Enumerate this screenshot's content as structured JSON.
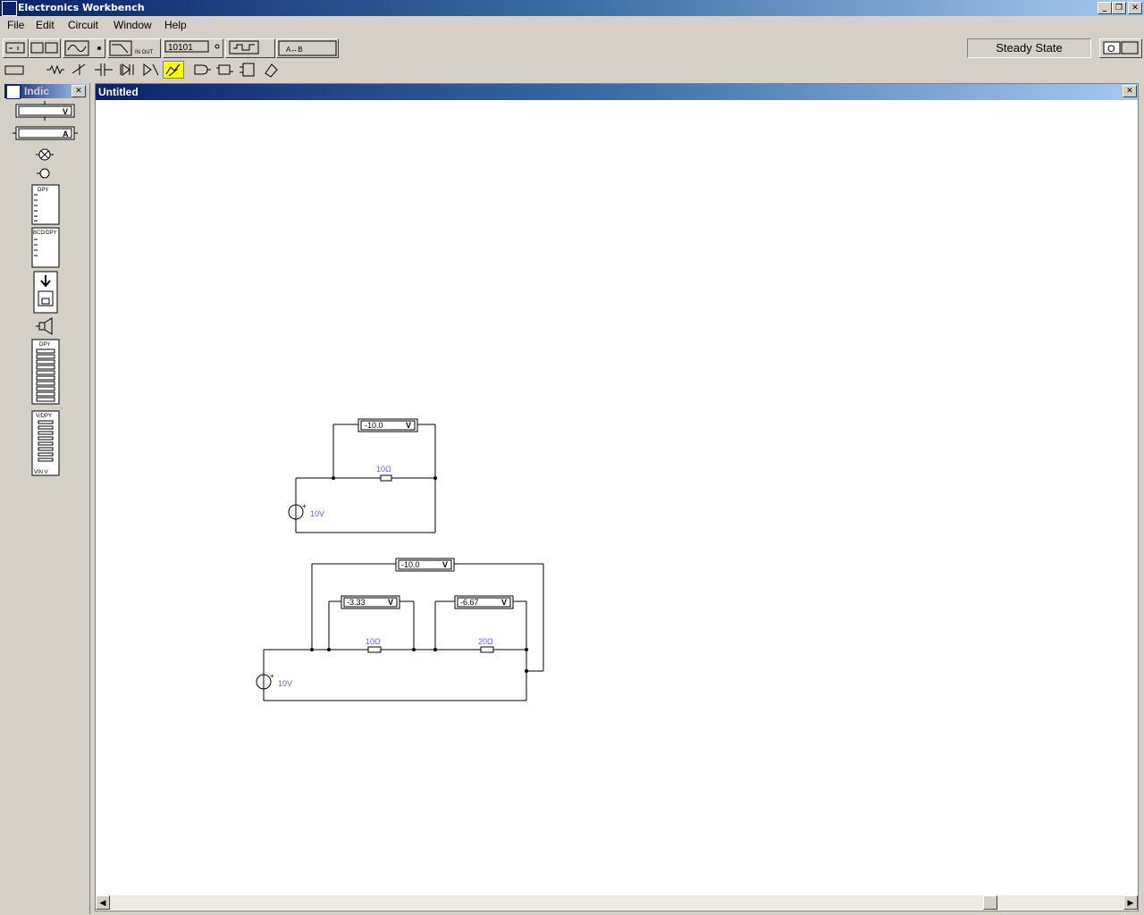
{
  "app": {
    "title": "Electronics Workbench",
    "window_buttons": {
      "minimize": "_",
      "restore": "❐",
      "close": "✕"
    }
  },
  "menu": [
    "File",
    "Edit",
    "Circuit",
    "Window",
    "Help"
  ],
  "toolbar": {
    "status": "Steady State",
    "power_label": "O",
    "instrument_labels": {
      "analyzer": "10101",
      "bode": "IN OUT",
      "logic": "A↔B"
    }
  },
  "parts_bin": {
    "title": "Indic",
    "voltmeter_label": "V",
    "ammeter_label": "A",
    "dpy_label": "DPY",
    "bcd_label": "BCD/DPY",
    "bargraph_label": "DPY",
    "vdpy_label": "V/DPY",
    "vin_label": "VIN V"
  },
  "canvas": {
    "title": "Untitled",
    "circuit1": {
      "voltmeter": {
        "reading": "-10.0",
        "unit": "V"
      },
      "resistor": "10Ω",
      "source": "10V"
    },
    "circuit2": {
      "voltmeter_total": {
        "reading": "-10.0",
        "unit": "V"
      },
      "voltmeter_r1": {
        "reading": "-3.33",
        "unit": "V"
      },
      "voltmeter_r2": {
        "reading": "-6.67",
        "unit": "V"
      },
      "resistor1": "10Ω",
      "resistor2": "20Ω",
      "source": "10V"
    }
  },
  "colors": {
    "component_label": "#5a6ad8",
    "title_gradient_start": "#0a246a",
    "title_gradient_end": "#a6caf0"
  }
}
